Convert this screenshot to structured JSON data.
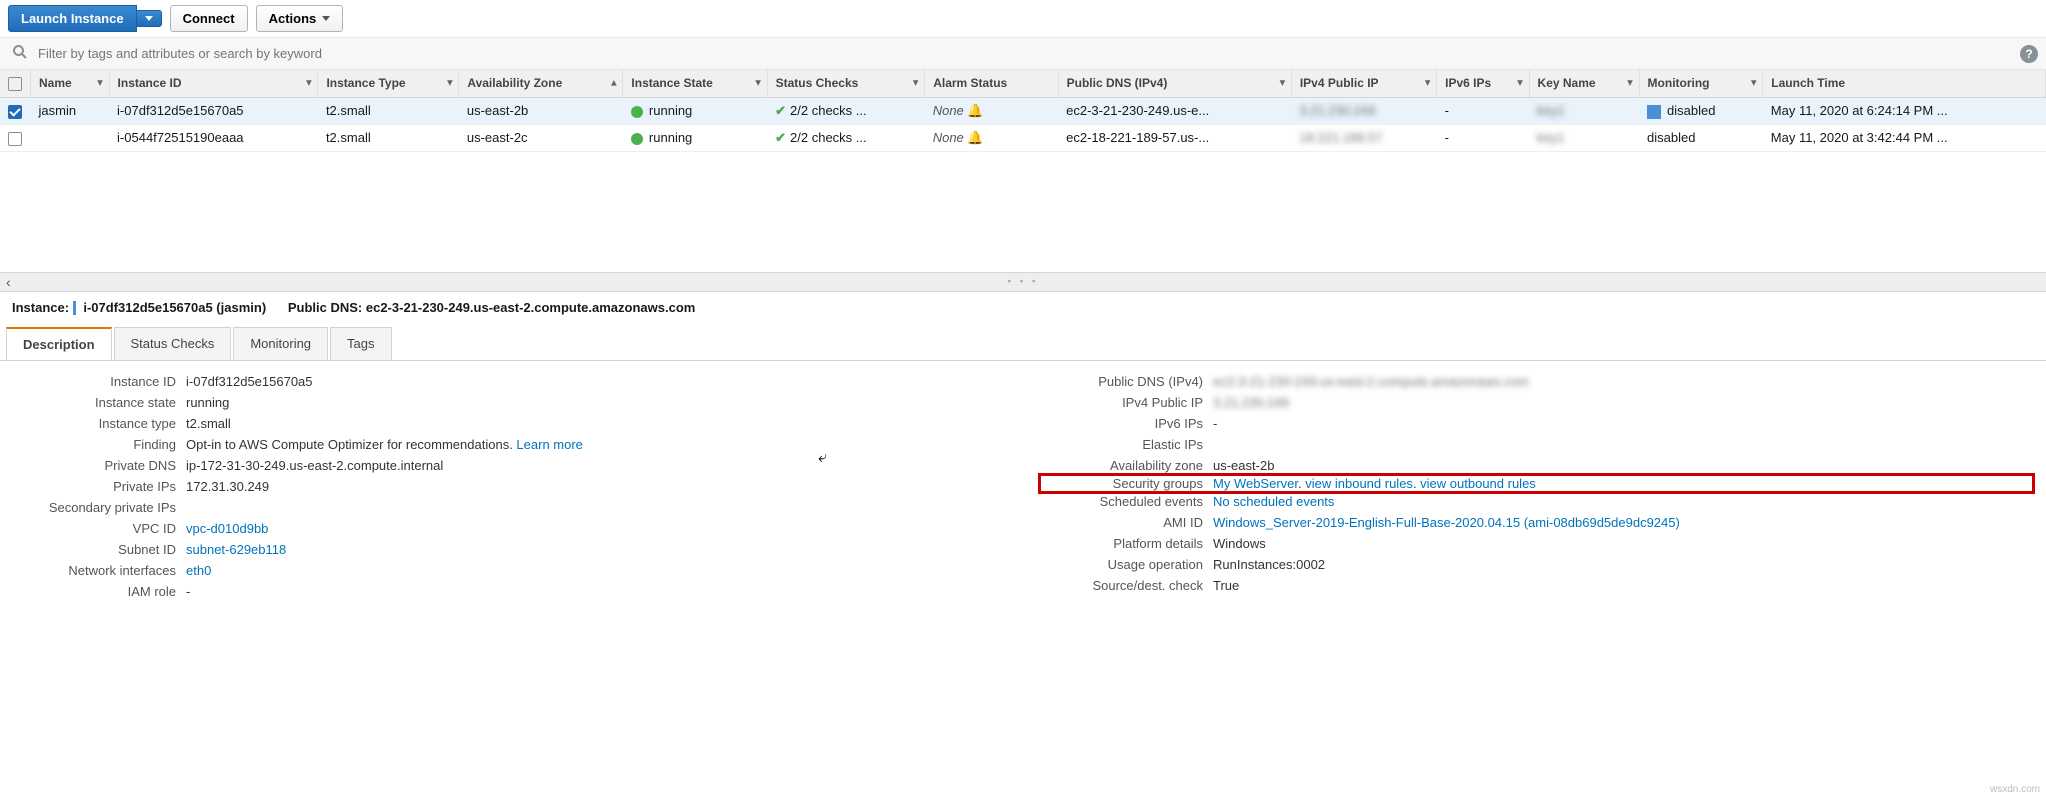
{
  "toolbar": {
    "launch": "Launch Instance",
    "connect": "Connect",
    "actions": "Actions"
  },
  "filter": {
    "placeholder": "Filter by tags and attributes or search by keyword"
  },
  "columns": {
    "name": "Name",
    "iid": "Instance ID",
    "itype": "Instance Type",
    "az": "Availability Zone",
    "istate": "Instance State",
    "schecks": "Status Checks",
    "alarm": "Alarm Status",
    "pdns": "Public DNS (IPv4)",
    "pip": "IPv4 Public IP",
    "ipv6": "IPv6 IPs",
    "key": "Key Name",
    "mon": "Monitoring",
    "ltime": "Launch Time"
  },
  "rows": [
    {
      "sel": true,
      "name": "jasmin",
      "iid": "i-07df312d5e15670a5",
      "itype": "t2.small",
      "az": "us-east-2b",
      "state": "running",
      "checks": "2/2 checks ...",
      "alarm": "None",
      "pdns": "ec2-3-21-230-249.us-e...",
      "pip": "3.21.230.249",
      "ipv6": "-",
      "key": "key1",
      "mon_sq": true,
      "mon": "disabled",
      "ltime": "May 11, 2020 at 6:24:14 PM ..."
    },
    {
      "sel": false,
      "name": "",
      "iid": "i-0544f72515190eaaa",
      "itype": "t2.small",
      "az": "us-east-2c",
      "state": "running",
      "checks": "2/2 checks ...",
      "alarm": "None",
      "pdns": "ec2-18-221-189-57.us-...",
      "pip": "18.221.189.57",
      "ipv6": "-",
      "key": "key1",
      "mon_sq": false,
      "mon": "disabled",
      "ltime": "May 11, 2020 at 3:42:44 PM ..."
    }
  ],
  "detail": {
    "instance_lbl": "Instance:",
    "instance_id": "i-07df312d5e15670a5 (jasmin)",
    "pdns_lbl": "Public DNS:",
    "pdns": "ec2-3-21-230-249.us-east-2.compute.amazonaws.com"
  },
  "tabs": {
    "desc": "Description",
    "sc": "Status Checks",
    "mon": "Monitoring",
    "tags": "Tags"
  },
  "desc_left": {
    "instance_id": {
      "k": "Instance ID",
      "v": "i-07df312d5e15670a5"
    },
    "instance_state": {
      "k": "Instance state",
      "v": "running"
    },
    "instance_type": {
      "k": "Instance type",
      "v": "t2.small"
    },
    "finding": {
      "k": "Finding",
      "v": "Opt-in to AWS Compute Optimizer for recommendations. ",
      "link": "Learn more"
    },
    "private_dns": {
      "k": "Private DNS",
      "v": "ip-172-31-30-249.us-east-2.compute.internal"
    },
    "private_ips": {
      "k": "Private IPs",
      "v": "172.31.30.249"
    },
    "sec_priv": {
      "k": "Secondary private IPs",
      "v": ""
    },
    "vpc": {
      "k": "VPC ID",
      "v": "vpc-d010d9bb"
    },
    "subnet": {
      "k": "Subnet ID",
      "v": "subnet-629eb118"
    },
    "nif": {
      "k": "Network interfaces",
      "v": "eth0"
    },
    "iam": {
      "k": "IAM role",
      "v": "-"
    }
  },
  "desc_right": {
    "pdns": {
      "k": "Public DNS (IPv4)",
      "v": "ec2-3-21-230-249.us-east-2.compute.amazonaws.com"
    },
    "pip": {
      "k": "IPv4 Public IP",
      "v": "3.21.230.249"
    },
    "ipv6": {
      "k": "IPv6 IPs",
      "v": "-"
    },
    "eip": {
      "k": "Elastic IPs",
      "v": ""
    },
    "az": {
      "k": "Availability zone",
      "v": "us-east-2b"
    },
    "sg": {
      "k": "Security groups",
      "v1": "My WebServer",
      "v2": "view inbound rules",
      "v3": "view outbound rules"
    },
    "sched": {
      "k": "Scheduled events",
      "v": "No scheduled events"
    },
    "ami": {
      "k": "AMI ID",
      "v": "Windows_Server-2019-English-Full-Base-2020.04.15 (ami-08db69d5de9dc9245)"
    },
    "plat": {
      "k": "Platform details",
      "v": "Windows"
    },
    "usage": {
      "k": "Usage operation",
      "v": "RunInstances:0002"
    },
    "sdc": {
      "k": "Source/dest. check",
      "v": "True"
    }
  },
  "watermark": "wsxdn.com"
}
